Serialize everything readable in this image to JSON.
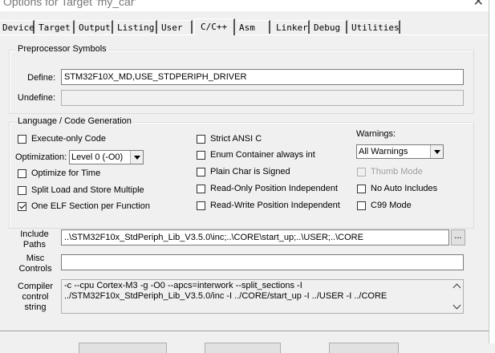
{
  "window": {
    "title": "Options for Target 'my_car'"
  },
  "tabs": [
    {
      "label": "Device"
    },
    {
      "label": "Target"
    },
    {
      "label": "Output"
    },
    {
      "label": "Listing"
    },
    {
      "label": "User"
    },
    {
      "label": "C/C++"
    },
    {
      "label": "Asm"
    },
    {
      "label": "Linker"
    },
    {
      "label": "Debug"
    },
    {
      "label": "Utilities"
    }
  ],
  "active_tab": "C/C++",
  "preprocessor": {
    "legend": "Preprocessor Symbols",
    "define_label": "Define:",
    "define_value": "STM32F10X_MD,USE_STDPERIPH_DRIVER",
    "undefine_label": "Undefine:",
    "undefine_value": ""
  },
  "language": {
    "legend": "Language / Code Generation",
    "execute_only": "Execute-only Code",
    "optimization_label": "Optimization:",
    "optimization_value": "Level 0 (-O0)",
    "optimize_time": "Optimize for Time",
    "split_load": "Split Load and Store Multiple",
    "one_elf": "One ELF Section per Function",
    "strict_ansi": "Strict ANSI C",
    "enum_container": "Enum Container always int",
    "plain_char": "Plain Char is Signed",
    "ro_pos": "Read-Only Position Independent",
    "rw_pos": "Read-Write Position Independent",
    "warnings_label": "Warnings:",
    "warnings_value": "All Warnings",
    "thumb_mode": "Thumb Mode",
    "no_auto_includes": "No Auto Includes",
    "c99_mode": "C99 Mode"
  },
  "include": {
    "label_line1": "Include",
    "label_line2": "Paths",
    "value": "..\\STM32F10x_StdPeriph_Lib_V3.5.0\\inc;..\\CORE\\start_up;..\\USER;..\\CORE",
    "browse": "..."
  },
  "misc": {
    "label_line1": "Misc",
    "label_line2": "Controls",
    "value": ""
  },
  "compiler": {
    "label_line1": "Compiler",
    "label_line2": "control",
    "label_line3": "string",
    "line1": "-c --cpu Cortex-M3 -g -O0 --apcs=interwork --split_sections -I",
    "line2": "../STM32F10x_StdPeriph_Lib_V3.5.0/inc -I ../CORE/start_up -I ../USER -I ../CORE"
  }
}
